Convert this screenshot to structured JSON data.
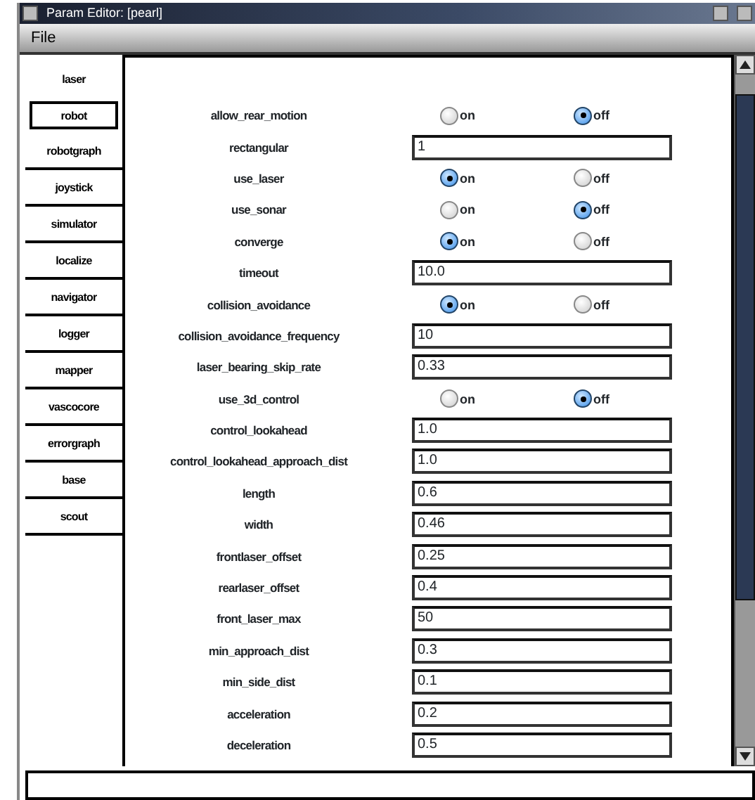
{
  "window": {
    "title": "Param Editor: [pearl]"
  },
  "menu": [
    "File"
  ],
  "tabs": [
    {
      "label": "laser",
      "selected": false
    },
    {
      "label": "robot",
      "selected": true
    },
    {
      "label": "robotgraph",
      "selected": false
    },
    {
      "label": "joystick",
      "selected": false
    },
    {
      "label": "simulator",
      "selected": false
    },
    {
      "label": "localize",
      "selected": false
    },
    {
      "label": "navigator",
      "selected": false
    },
    {
      "label": "logger",
      "selected": false
    },
    {
      "label": "mapper",
      "selected": false
    },
    {
      "label": "vascocore",
      "selected": false
    },
    {
      "label": "errorgraph",
      "selected": false
    },
    {
      "label": "base",
      "selected": false
    },
    {
      "label": "scout",
      "selected": false
    }
  ],
  "params": [
    {
      "name": "allow_rear_motion",
      "kind": "radio",
      "options": [
        {
          "label": "on",
          "selected": false
        },
        {
          "label": "off",
          "selected": true
        }
      ]
    },
    {
      "name": "rectangular",
      "kind": "text",
      "value": "1"
    },
    {
      "name": "use_laser",
      "kind": "radio",
      "options": [
        {
          "label": "on",
          "selected": true
        },
        {
          "label": "off",
          "selected": false
        }
      ]
    },
    {
      "name": "use_sonar",
      "kind": "radio",
      "options": [
        {
          "label": "on",
          "selected": false
        },
        {
          "label": "off",
          "selected": true
        }
      ]
    },
    {
      "name": "converge",
      "kind": "radio",
      "options": [
        {
          "label": "on",
          "selected": true
        },
        {
          "label": "off",
          "selected": false
        }
      ]
    },
    {
      "name": "timeout",
      "kind": "text",
      "value": "10.0"
    },
    {
      "name": "collision_avoidance",
      "kind": "radio",
      "options": [
        {
          "label": "on",
          "selected": true
        },
        {
          "label": "off",
          "selected": false
        }
      ]
    },
    {
      "name": "collision_avoidance_frequency",
      "kind": "text",
      "value": "10"
    },
    {
      "name": "laser_bearing_skip_rate",
      "kind": "text",
      "value": "0.33"
    },
    {
      "name": "use_3d_control",
      "kind": "radio",
      "options": [
        {
          "label": "on",
          "selected": false
        },
        {
          "label": "off",
          "selected": true
        }
      ]
    },
    {
      "name": "control_lookahead",
      "kind": "text",
      "value": "1.0"
    },
    {
      "name": "control_lookahead_approach_dist",
      "kind": "text",
      "value": "1.0"
    },
    {
      "name": "length",
      "kind": "text",
      "value": "0.6"
    },
    {
      "name": "width",
      "kind": "text",
      "value": "0.46"
    },
    {
      "name": "frontlaser_offset",
      "kind": "text",
      "value": "0.25"
    },
    {
      "name": "rearlaser_offset",
      "kind": "text",
      "value": "0.4"
    },
    {
      "name": "front_laser_max",
      "kind": "text",
      "value": "50"
    },
    {
      "name": "min_approach_dist",
      "kind": "text",
      "value": "0.3"
    },
    {
      "name": "min_side_dist",
      "kind": "text",
      "value": "0.1"
    },
    {
      "name": "acceleration",
      "kind": "text",
      "value": "0.2"
    },
    {
      "name": "deceleration",
      "kind": "text",
      "value": "0.5"
    }
  ]
}
